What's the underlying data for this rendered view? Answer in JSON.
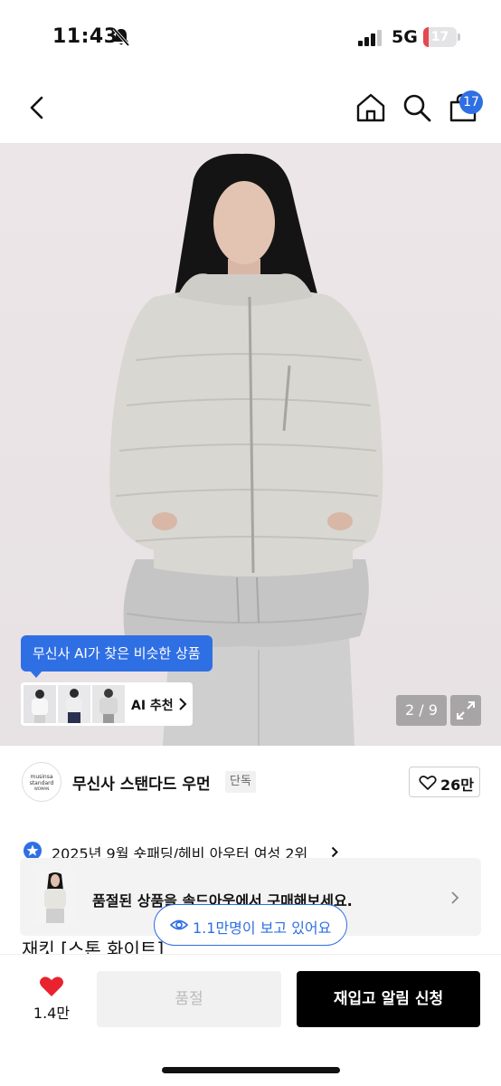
{
  "status_bar": {
    "time": "11:43",
    "network": "5G",
    "battery_percent": "17",
    "battery_level": 0.17,
    "battery_color": "#e5484d",
    "icons": [
      "bell-slash-icon",
      "signal-icon",
      "battery-icon"
    ]
  },
  "nav": {
    "icons": [
      "back-icon",
      "home-icon",
      "search-icon",
      "cart-icon"
    ],
    "cart_count": "17",
    "accent": "#2f6fe4"
  },
  "hero": {
    "ai_tooltip": "무신사 AI가 찾은 비슷한 상품",
    "ai_recommend_label": "AI 추천",
    "pager": "2 / 9"
  },
  "brand": {
    "logo_text_line1": "musinsa",
    "logo_text_line2": "standard",
    "logo_text_line3": "WOMAN",
    "name": "무신사 스탠다드 우먼",
    "badge": "단독",
    "like_count": "26만"
  },
  "ranking": {
    "text": "2025년 9월 숏패딩/헤비 아우터 여성 2위"
  },
  "product": {
    "title_partial": "재킷 [스톤 화이트]"
  },
  "soldout_banner": {
    "text": "품절된 상품을 솔드아웃에서 구매해보세요."
  },
  "viewers": {
    "text": "1.1만명이 보고 있어요"
  },
  "bottom_bar": {
    "wish_count": "1.4만",
    "wish_color": "#e8232f",
    "soldout_label": "품절",
    "restock_label": "재입고 알림 신청"
  }
}
